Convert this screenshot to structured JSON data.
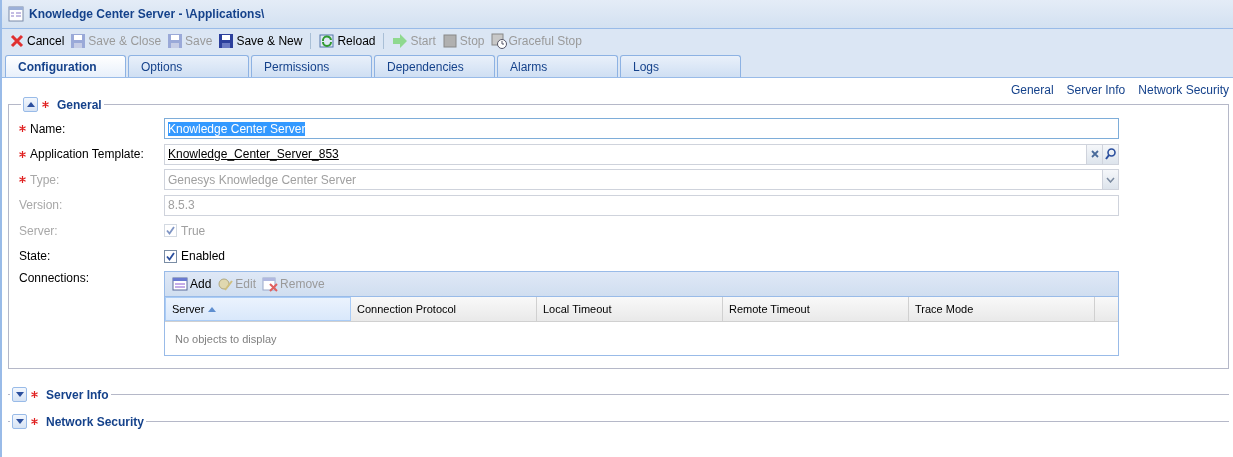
{
  "window": {
    "title": "Knowledge Center Server - \\Applications\\"
  },
  "toolbar": {
    "groups": [
      {
        "buttons": [
          {
            "label": "Cancel",
            "disabled": false
          },
          {
            "label": "Save & Close",
            "disabled": true
          },
          {
            "label": "Save",
            "disabled": true
          },
          {
            "label": "Save & New",
            "disabled": false
          }
        ]
      },
      {
        "buttons": [
          {
            "label": "Reload",
            "disabled": false
          }
        ]
      },
      {
        "buttons": [
          {
            "label": "Start",
            "disabled": true
          },
          {
            "label": "Stop",
            "disabled": true
          },
          {
            "label": "Graceful Stop",
            "disabled": true
          }
        ]
      }
    ]
  },
  "tabs": [
    {
      "label": "Configuration",
      "selected": true
    },
    {
      "label": "Options",
      "selected": false
    },
    {
      "label": "Permissions",
      "selected": false
    },
    {
      "label": "Dependencies",
      "selected": false
    },
    {
      "label": "Alarms",
      "selected": false
    },
    {
      "label": "Logs",
      "selected": false
    }
  ],
  "section_links": [
    "General",
    "Server Info",
    "Network Security"
  ],
  "sections": [
    {
      "title": "General",
      "required": true,
      "expanded": true,
      "fields": [
        {
          "kind": "text",
          "label": "Name:",
          "required": true,
          "disabled": false,
          "value": "Knowledge Center Server",
          "text_selected": true
        },
        {
          "kind": "lookup",
          "label": "Application Template:",
          "required": true,
          "disabled": false,
          "value": "Knowledge_Center_Server_853"
        },
        {
          "kind": "select",
          "label": "Type:",
          "required": true,
          "disabled": true,
          "value": "Genesys Knowledge Center Server"
        },
        {
          "kind": "text",
          "label": "Version:",
          "required": false,
          "disabled": true,
          "value": "8.5.3",
          "text_selected": false
        },
        {
          "kind": "checkbox",
          "label": "Server:",
          "required": false,
          "disabled": true,
          "checked": true,
          "value": "True"
        },
        {
          "kind": "checkbox",
          "label": "State:",
          "required": false,
          "disabled": false,
          "checked": true,
          "value": "Enabled"
        },
        {
          "kind": "grid",
          "label": "Connections:",
          "required": false,
          "disabled": false,
          "buttons": [
            {
              "label": "Add",
              "disabled": false
            },
            {
              "label": "Edit",
              "disabled": true
            },
            {
              "label": "Remove",
              "disabled": true
            }
          ],
          "columns": [
            {
              "label": "Server",
              "sorted": true
            },
            {
              "label": "Connection Protocol",
              "sorted": false
            },
            {
              "label": "Local Timeout",
              "sorted": false
            },
            {
              "label": "Remote Timeout",
              "sorted": false
            },
            {
              "label": "Trace Mode",
              "sorted": false
            }
          ],
          "empty_text": "No objects to display"
        }
      ]
    },
    {
      "title": "Server Info",
      "required": true,
      "expanded": false
    },
    {
      "title": "Network Security",
      "required": true,
      "expanded": false
    }
  ]
}
